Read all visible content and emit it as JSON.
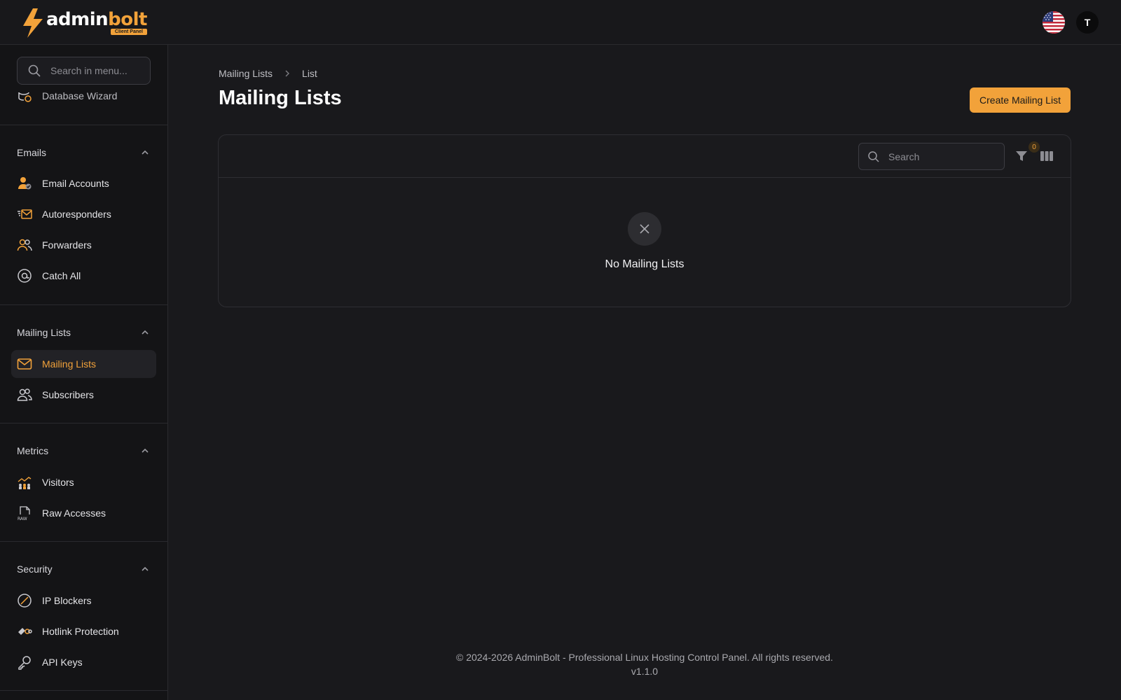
{
  "brand": {
    "name_part1": "admin",
    "name_part2": "bolt",
    "tag": "Client Panel",
    "accent_color": "#f2a23a"
  },
  "header": {
    "language_flag": "us-flag-icon",
    "avatar_initial": "T"
  },
  "sidebar": {
    "search_placeholder": "Search in menu...",
    "partial_item": "Database Wizard",
    "groups": [
      {
        "title": "Emails",
        "items": [
          {
            "label": "Email Accounts",
            "icon": "email-account-icon"
          },
          {
            "label": "Autoresponders",
            "icon": "autoresponder-icon"
          },
          {
            "label": "Forwarders",
            "icon": "forwarders-icon"
          },
          {
            "label": "Catch All",
            "icon": "at-icon"
          }
        ]
      },
      {
        "title": "Mailing Lists",
        "items": [
          {
            "label": "Mailing Lists",
            "icon": "envelope-icon",
            "active": true
          },
          {
            "label": "Subscribers",
            "icon": "subscribers-icon"
          }
        ]
      },
      {
        "title": "Metrics",
        "items": [
          {
            "label": "Visitors",
            "icon": "visitors-icon"
          },
          {
            "label": "Raw Accesses",
            "icon": "raw-file-icon"
          }
        ]
      },
      {
        "title": "Security",
        "items": [
          {
            "label": "IP Blockers",
            "icon": "block-icon"
          },
          {
            "label": "Hotlink Protection",
            "icon": "hotlink-icon"
          },
          {
            "label": "API Keys",
            "icon": "key-icon"
          }
        ]
      }
    ]
  },
  "main": {
    "breadcrumb": [
      "Mailing Lists",
      "List"
    ],
    "title": "Mailing Lists",
    "create_button": "Create Mailing List",
    "table": {
      "search_placeholder": "Search",
      "filter_count": "0",
      "empty_text": "No Mailing Lists"
    }
  },
  "footer": {
    "copyright": "© 2024-2026 AdminBolt - Professional Linux Hosting Control Panel. All rights reserved.",
    "version": "v1.1.0"
  }
}
